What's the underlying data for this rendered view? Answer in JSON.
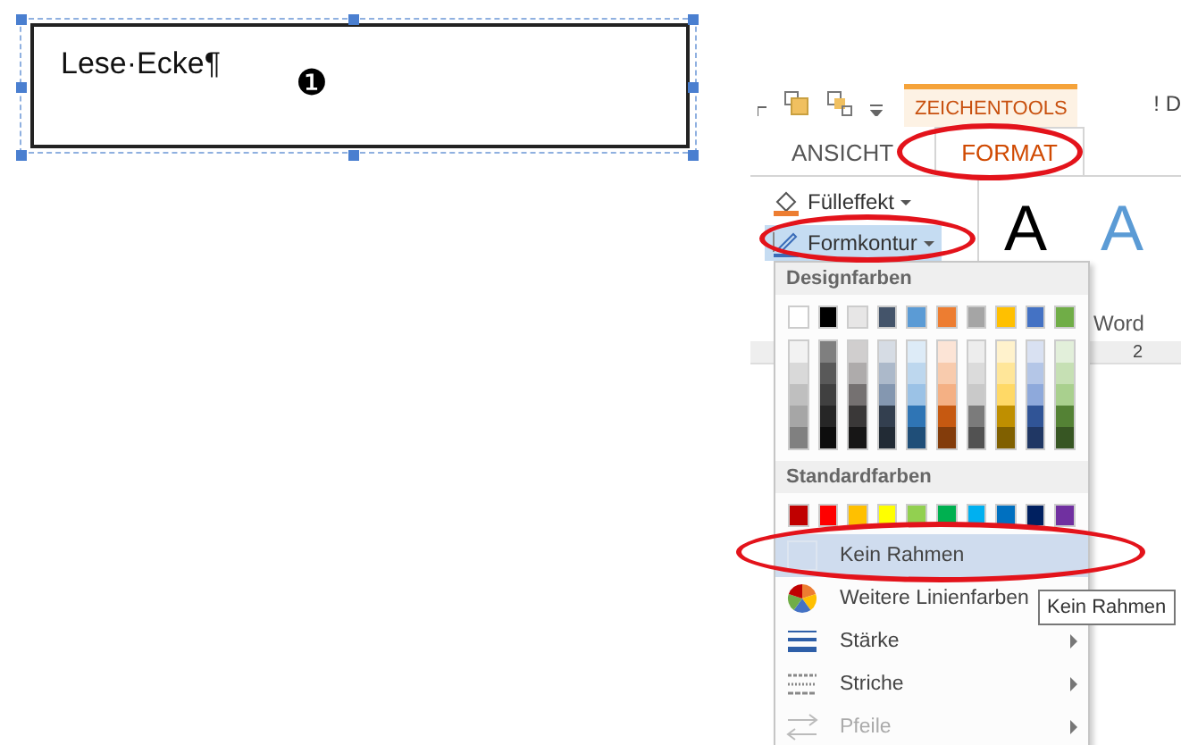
{
  "textbox": {
    "text": "Lese·Ecke¶",
    "marker": "❶",
    "selected": true
  },
  "ribbon": {
    "contextual_tab": "ZEICHENTOOLS",
    "title_fragment": "! D",
    "tabs": [
      {
        "label": "ANSICHT",
        "selected": false
      },
      {
        "label": "FORMAT",
        "selected": true
      }
    ],
    "buttons": [
      {
        "label": "Fülleffekt",
        "kind": "fill",
        "highlighted": false
      },
      {
        "label": "Formkontur",
        "kind": "outline",
        "highlighted": true
      }
    ],
    "styles": [
      {
        "label": "A",
        "color": "#000000"
      },
      {
        "label": "A",
        "color": "#5b9bd5"
      }
    ],
    "group_fragment": "Word",
    "ruler_mark": "2"
  },
  "menu": {
    "theme_header": "Designfarben",
    "theme_colors": [
      {
        "color": "#ffffff",
        "shades": [
          {
            "color": "#f2f2f2"
          },
          {
            "color": "#d9d9d9"
          },
          {
            "color": "#bfbfbf"
          },
          {
            "color": "#a6a6a6"
          },
          {
            "color": "#808080"
          }
        ]
      },
      {
        "color": "#000000",
        "shades": [
          {
            "color": "#7f7f7f"
          },
          {
            "color": "#595959"
          },
          {
            "color": "#404040"
          },
          {
            "color": "#262626"
          },
          {
            "color": "#0d0d0d"
          }
        ]
      },
      {
        "color": "#e7e6e6",
        "shades": [
          {
            "color": "#d0cece"
          },
          {
            "color": "#aeabab"
          },
          {
            "color": "#757171"
          },
          {
            "color": "#3a3838"
          },
          {
            "color": "#171616"
          }
        ]
      },
      {
        "color": "#44546a",
        "shades": [
          {
            "color": "#d6dce4"
          },
          {
            "color": "#acb9ca"
          },
          {
            "color": "#8497b0"
          },
          {
            "color": "#333f4f"
          },
          {
            "color": "#222b35"
          }
        ]
      },
      {
        "color": "#5b9bd5",
        "shades": [
          {
            "color": "#ddebf7"
          },
          {
            "color": "#bdd7ee"
          },
          {
            "color": "#9bc2e6"
          },
          {
            "color": "#2f75b5"
          },
          {
            "color": "#1f4e78"
          }
        ]
      },
      {
        "color": "#ed7d31",
        "shades": [
          {
            "color": "#fce4d6"
          },
          {
            "color": "#f8cbad"
          },
          {
            "color": "#f4b084"
          },
          {
            "color": "#c65911"
          },
          {
            "color": "#833c0b"
          }
        ]
      },
      {
        "color": "#a5a5a5",
        "shades": [
          {
            "color": "#ededed"
          },
          {
            "color": "#dbdbdb"
          },
          {
            "color": "#c9c9c9"
          },
          {
            "color": "#7b7b7b"
          },
          {
            "color": "#525252"
          }
        ]
      },
      {
        "color": "#ffc000",
        "shades": [
          {
            "color": "#fff2cc"
          },
          {
            "color": "#ffe699"
          },
          {
            "color": "#ffd966"
          },
          {
            "color": "#bf8f00"
          },
          {
            "color": "#806000"
          }
        ]
      },
      {
        "color": "#4472c4",
        "shades": [
          {
            "color": "#d9e1f2"
          },
          {
            "color": "#b4c6e7"
          },
          {
            "color": "#8ea9db"
          },
          {
            "color": "#305496"
          },
          {
            "color": "#203764"
          }
        ]
      },
      {
        "color": "#70ad47",
        "shades": [
          {
            "color": "#e2efda"
          },
          {
            "color": "#c6e0b4"
          },
          {
            "color": "#a9d08e"
          },
          {
            "color": "#548235"
          },
          {
            "color": "#375623"
          }
        ]
      }
    ],
    "standard_header": "Standardfarben",
    "standard_colors": [
      {
        "color": "#c00000"
      },
      {
        "color": "#ff0000"
      },
      {
        "color": "#ffc000"
      },
      {
        "color": "#ffff00"
      },
      {
        "color": "#92d050"
      },
      {
        "color": "#00b050"
      },
      {
        "color": "#00b0f0"
      },
      {
        "color": "#0070c0"
      },
      {
        "color": "#002060"
      },
      {
        "color": "#7030a0"
      }
    ],
    "items": [
      {
        "label": "Kein Rahmen",
        "kind": "no-border",
        "highlighted": true,
        "disabled": false
      },
      {
        "label": "Weitere Linienfarben",
        "kind": "more-colors",
        "highlighted": false,
        "disabled": false
      },
      {
        "label": "Stärke",
        "kind": "weight",
        "highlighted": false,
        "disabled": false
      },
      {
        "label": "Striche",
        "kind": "dashes",
        "highlighted": false,
        "disabled": false
      },
      {
        "label": "Pfeile",
        "kind": "arrows",
        "highlighted": false,
        "disabled": true
      }
    ]
  },
  "tooltip": {
    "text": "Kein Rahmen"
  }
}
